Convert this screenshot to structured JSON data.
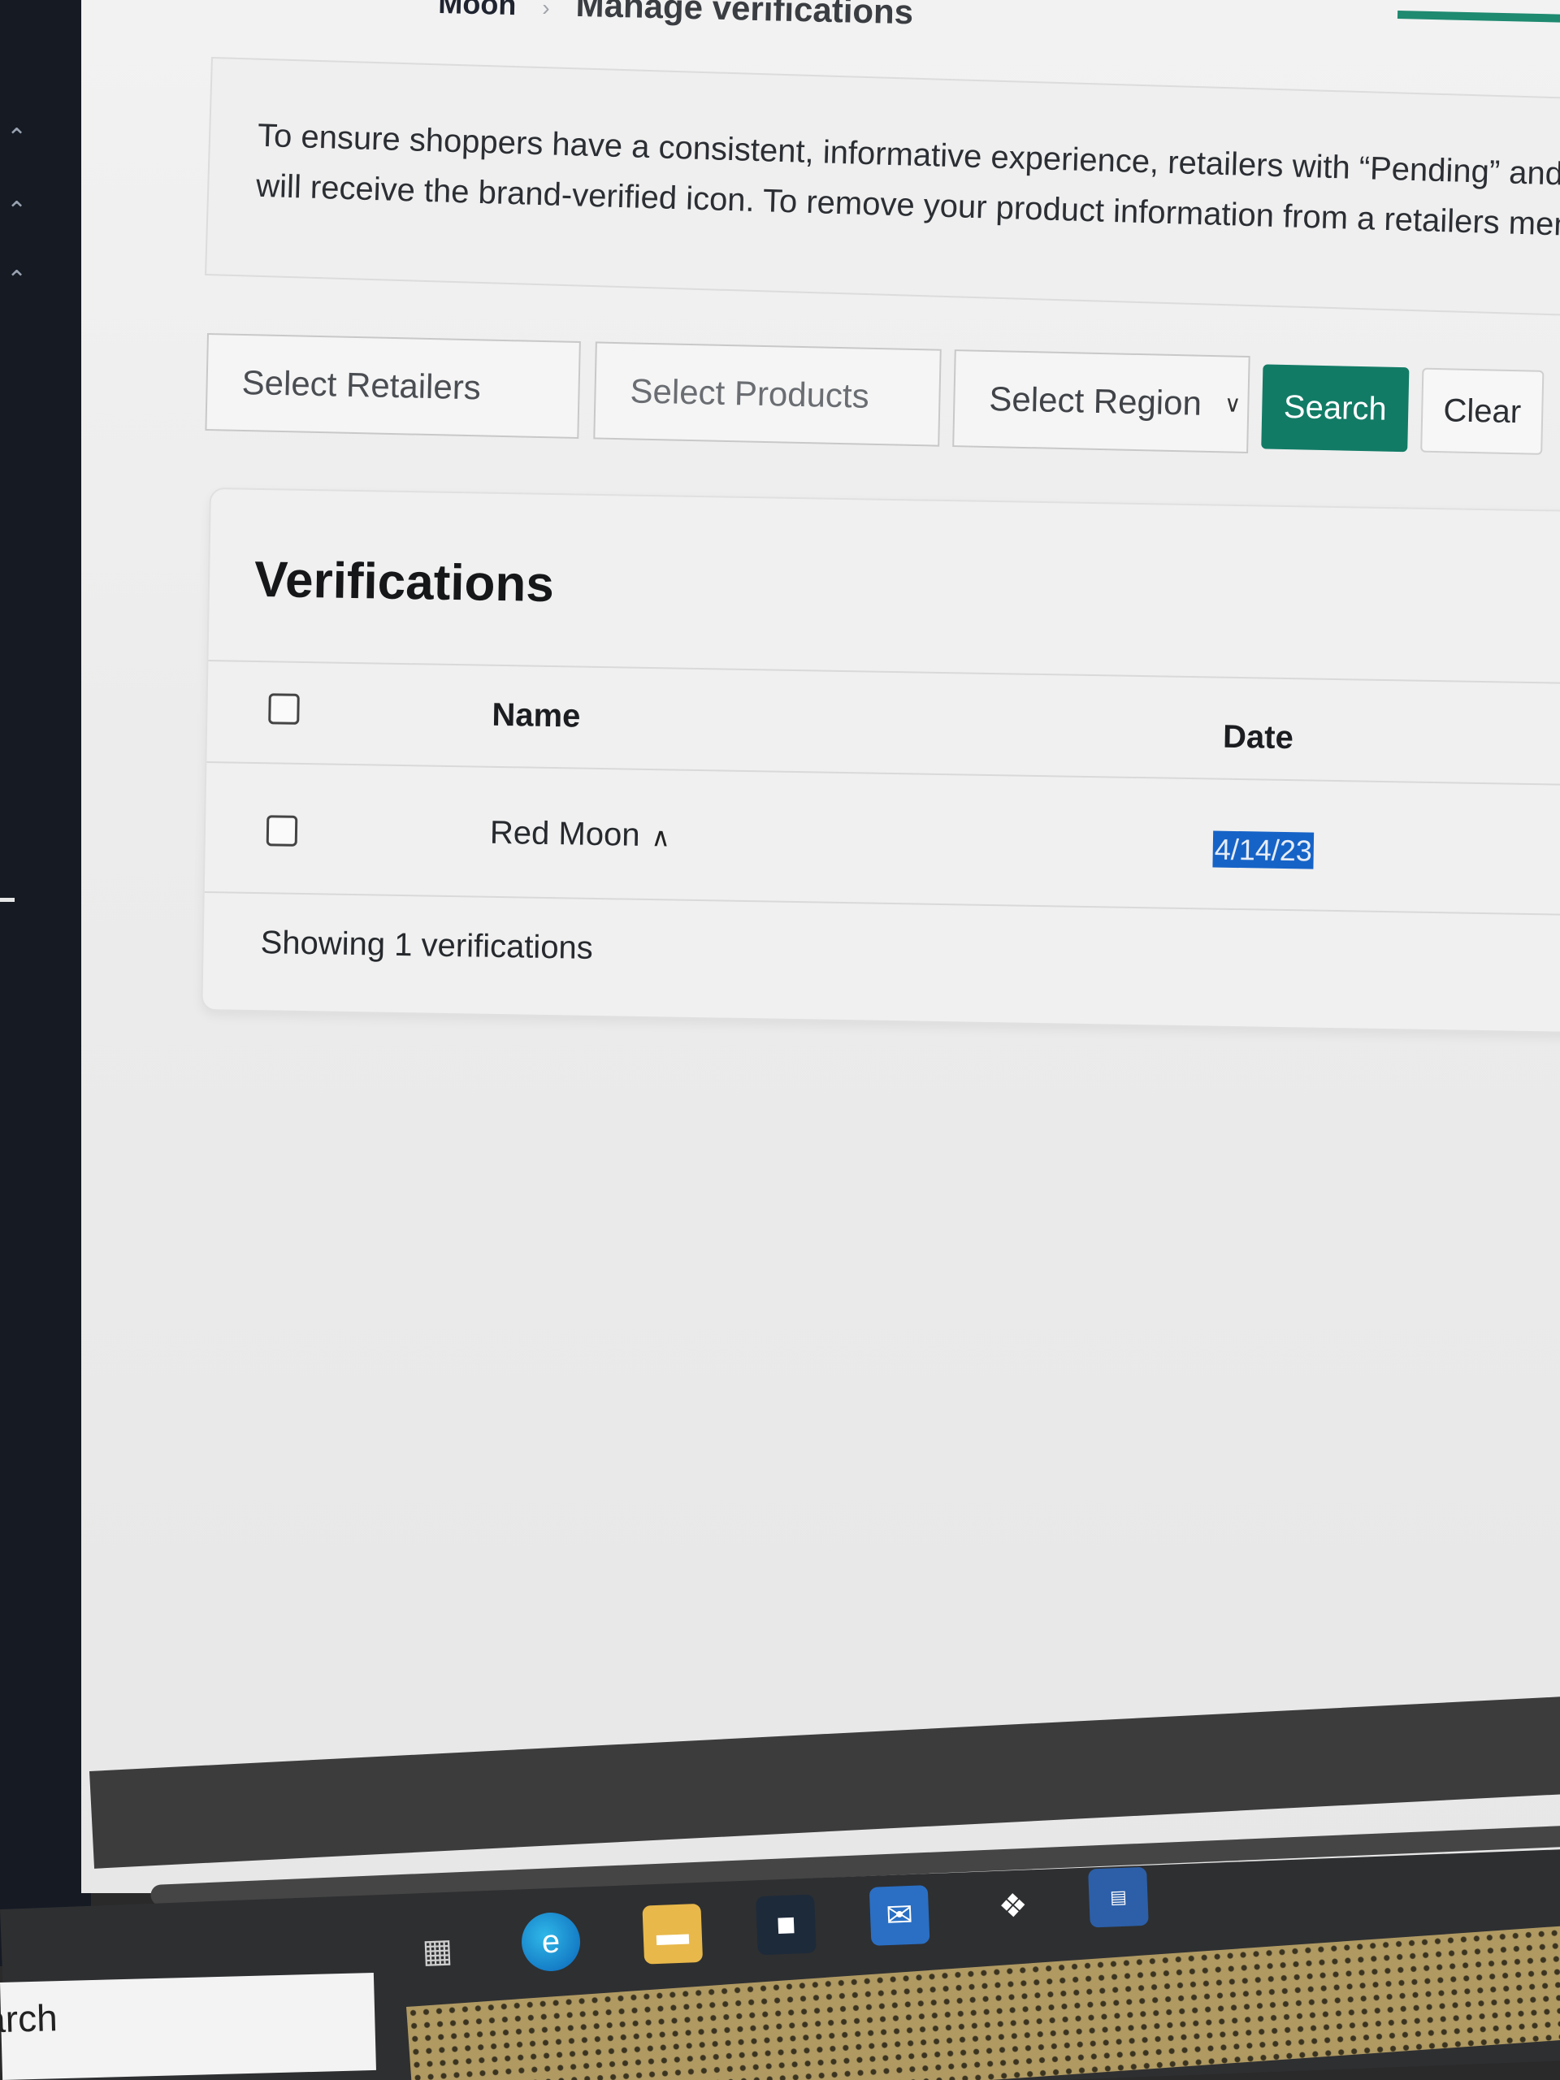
{
  "breadcrumb": {
    "parent": "Moon",
    "separator": "›",
    "current": "Manage verifications"
  },
  "notice": {
    "line1": "To ensure shoppers have a consistent, informative experience, retailers with “Pending” and “Ex",
    "line2": "will receive the brand-verified icon. To remove your product information from a retailers menu,"
  },
  "filters": {
    "retailers_placeholder": "Select Retailers",
    "products_placeholder": "Select Products",
    "region_placeholder": "Select Region",
    "search_label": "Search",
    "clear_label": "Clear"
  },
  "verifications": {
    "title": "Verifications",
    "columns": {
      "name": "Name",
      "date": "Date"
    },
    "rows": [
      {
        "name": "Red Moon",
        "date": "4/14/23",
        "checked": false
      }
    ],
    "footer": "Showing 1 verifications"
  },
  "taskbar": {
    "search_text": "arch",
    "icons": [
      "task-view-icon",
      "edge-icon",
      "file-explorer-icon",
      "store-icon",
      "mail-icon",
      "dropbox-icon",
      "app-icon"
    ]
  },
  "colors": {
    "accent": "#127b66",
    "selection": "#1663c7",
    "sidebar": "#151a23"
  }
}
